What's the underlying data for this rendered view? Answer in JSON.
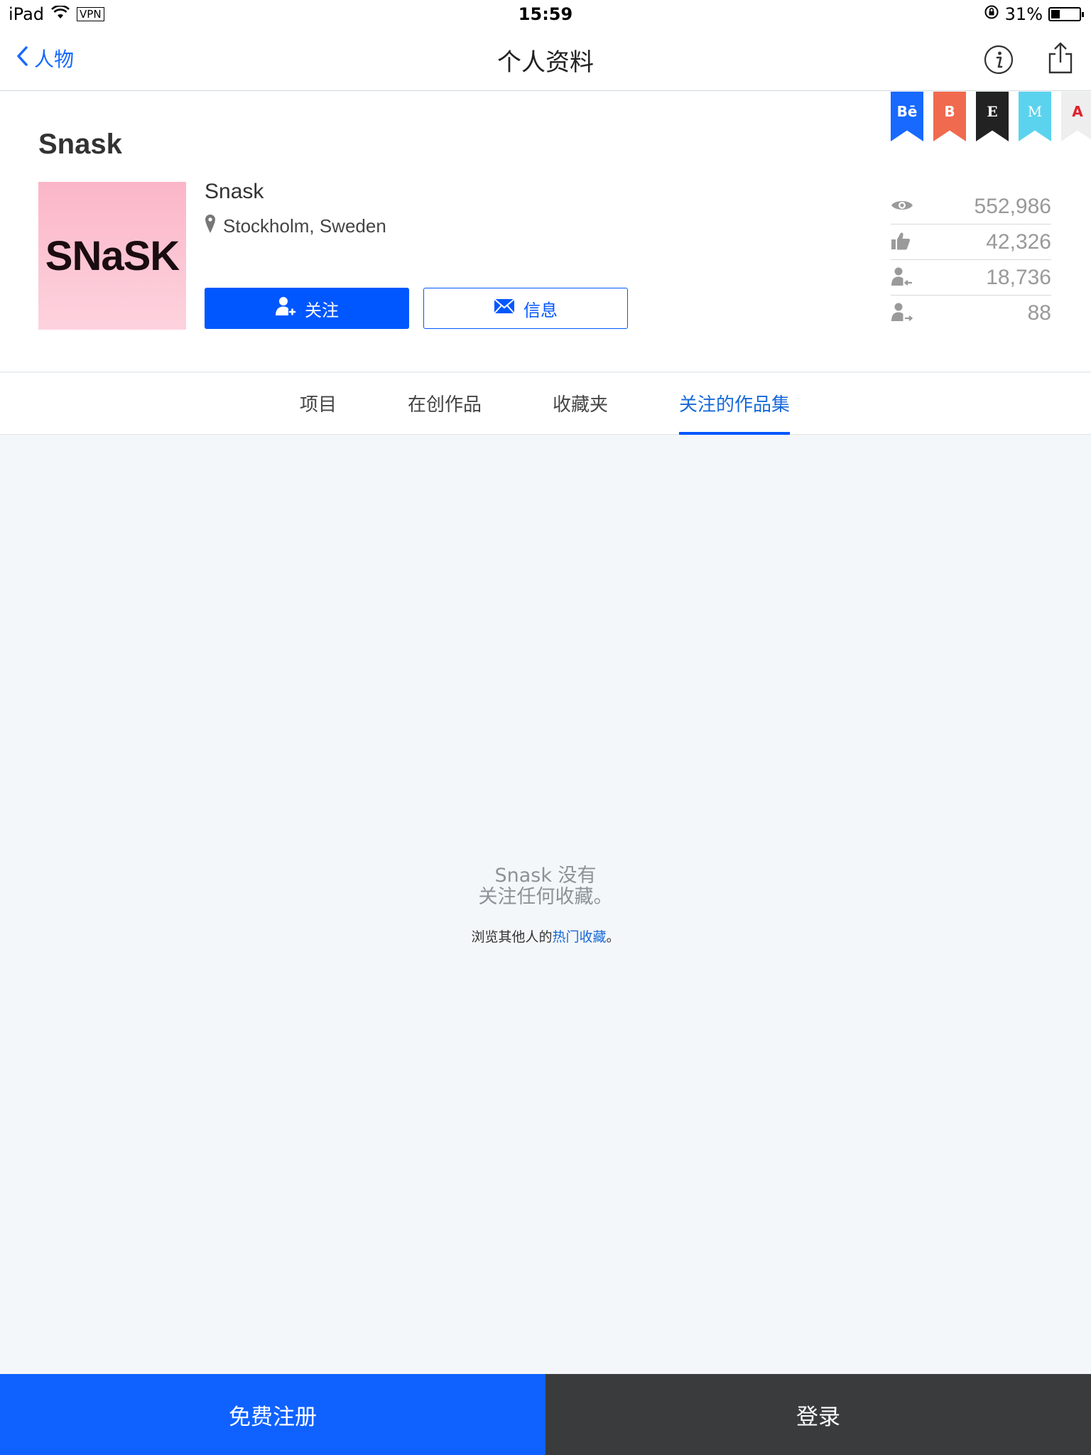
{
  "status_bar": {
    "device": "iPad",
    "vpn": "VPN",
    "time": "15:59",
    "battery": "31%",
    "battery_level": 0.31
  },
  "nav": {
    "back_label": "人物",
    "title": "个人资料"
  },
  "profile": {
    "title": "Snask",
    "avatar_text": "SNaSK",
    "name": "Snask",
    "location": "Stockholm, Sweden",
    "follow_label": "关注",
    "message_label": "信息"
  },
  "ribbons": [
    {
      "label": "Bē",
      "color": "#1769ff"
    },
    {
      "label": "B",
      "color": "#f06a4f"
    },
    {
      "label": "E",
      "color": "#222222"
    },
    {
      "label": "M",
      "color": "#5bd3ee"
    },
    {
      "label": "A",
      "color": "#eeeeee"
    }
  ],
  "stats": {
    "views": "552,986",
    "appreciations": "42,326",
    "followers": "18,736",
    "following": "88"
  },
  "tabs": [
    {
      "label": "项目",
      "active": false
    },
    {
      "label": "在创作品",
      "active": false
    },
    {
      "label": "收藏夹",
      "active": false
    },
    {
      "label": "关注的作品集",
      "active": true
    }
  ],
  "empty_state": {
    "line1": "Snask 没有",
    "line2": "关注任何收藏。",
    "browse_prefix": "浏览其他人的",
    "browse_link": "热门收藏",
    "browse_suffix": "。"
  },
  "bottom": {
    "signup_label": "免费注册",
    "login_label": "登录"
  },
  "colors": {
    "accent": "#0057ff",
    "link": "#1769d8",
    "login_bg": "#3a3b3d"
  }
}
